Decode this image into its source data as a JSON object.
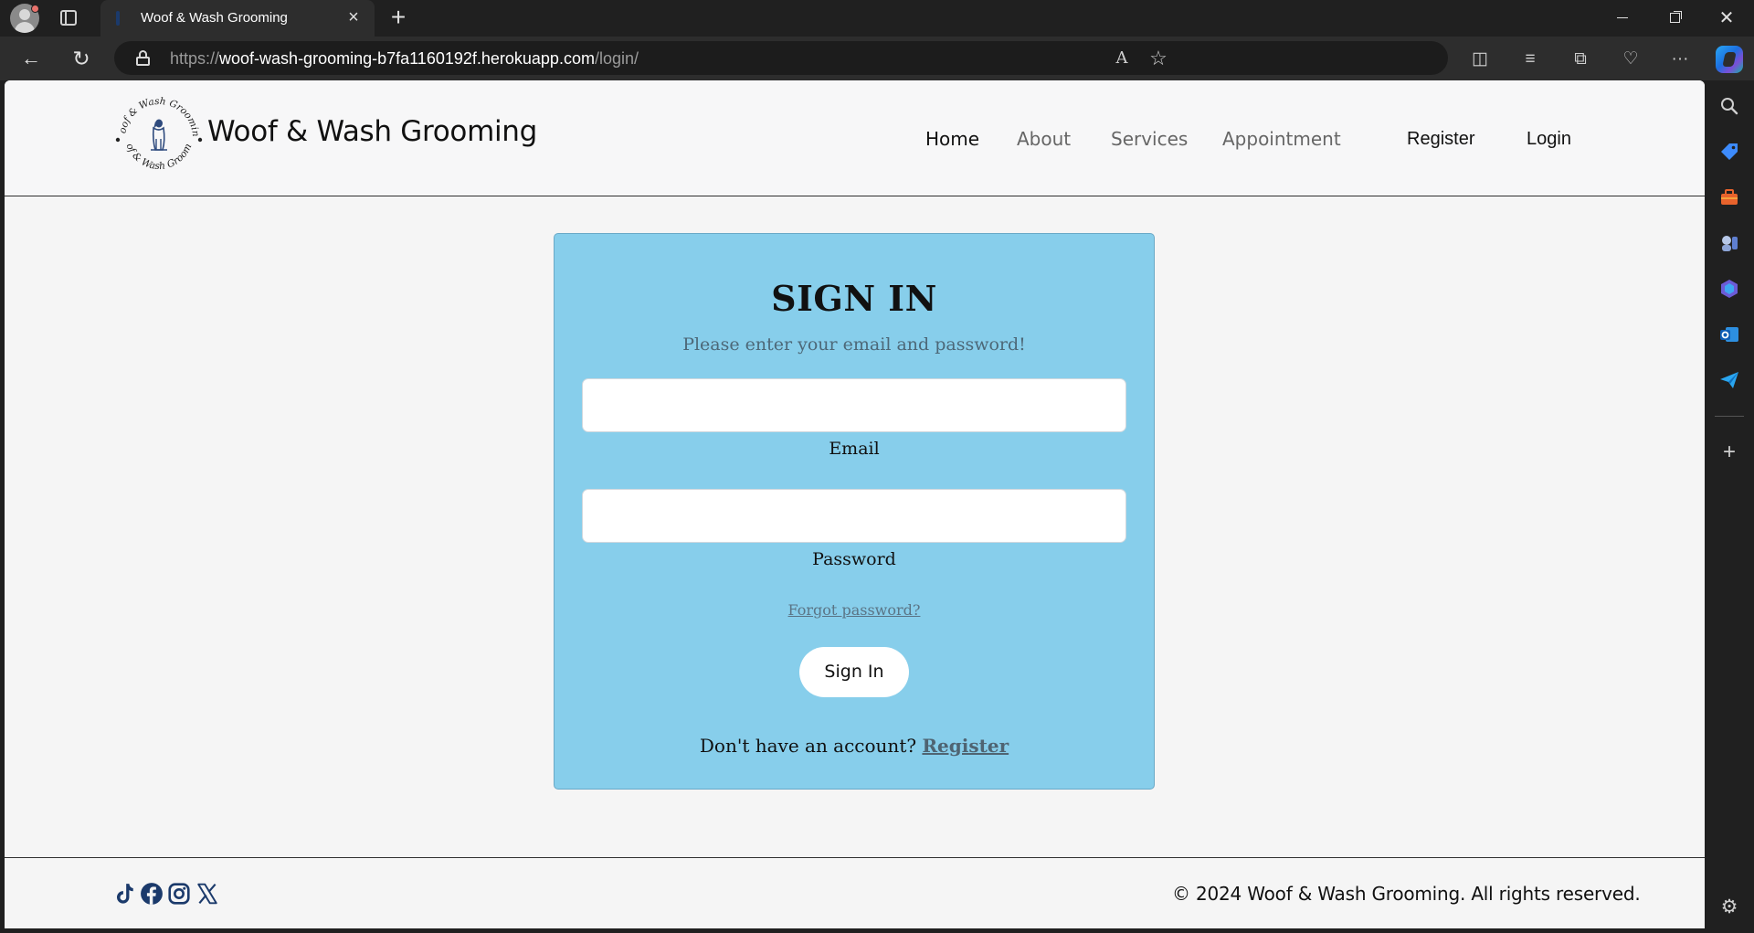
{
  "browser": {
    "tab_title": "Woof & Wash Grooming",
    "url_scheme": "https://",
    "url_host": "woof-wash-grooming-b7fa1160192f.herokuapp.com",
    "url_path": "/login/",
    "icons": {
      "new_tab": "+",
      "close_tab": "×",
      "back": "←",
      "reload": "↻",
      "read_aloud": "A",
      "favorite": "☆",
      "split_screen": "◫",
      "favorites": "≡",
      "collections": "⧉",
      "browser_essentials": "♡",
      "more": "···",
      "sidebar_add": "+",
      "sidebar_settings": "⚙"
    }
  },
  "site": {
    "brand": "Woof & Wash Grooming",
    "logo_text": "Woof & Wash Grooming",
    "nav": {
      "home": "Home",
      "about": "About",
      "services": "Services",
      "appointment": "Appointment",
      "register": "Register",
      "login": "Login"
    }
  },
  "signin": {
    "title": "SIGN IN",
    "subtitle": "Please enter your email and password!",
    "email_label": "Email",
    "email_value": "",
    "password_label": "Password",
    "password_value": "",
    "forgot_link": "Forgot password?",
    "button": "Sign In",
    "no_account_text": "Don't have an account?",
    "register_link": "Register"
  },
  "footer": {
    "social": [
      "tiktok-icon",
      "facebook-icon",
      "instagram-icon",
      "x-icon"
    ],
    "copyright": "© 2024 Woof & Wash Grooming. All rights reserved."
  },
  "colors": {
    "card_background": "#87ceeb",
    "page_background": "#f5f5f5",
    "social_icon": "#1b3a6b",
    "browser_chrome": "#202020"
  }
}
